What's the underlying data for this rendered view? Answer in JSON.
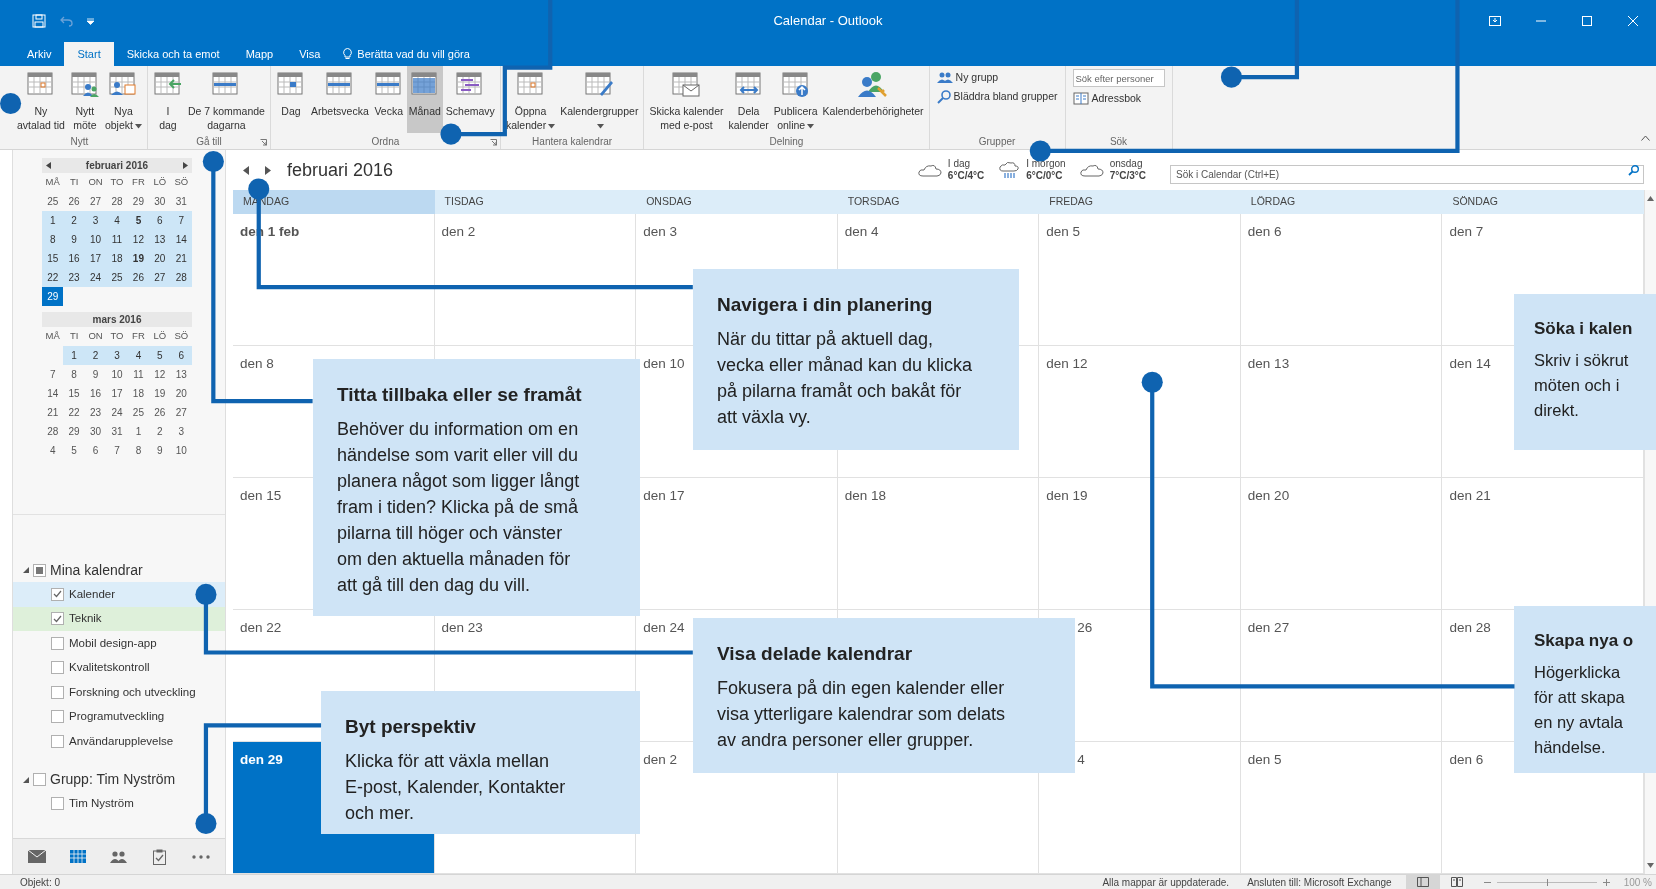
{
  "window": {
    "title": "Calendar - Outlook"
  },
  "ribbon_tabs": [
    {
      "label": "Arkiv",
      "selected": false
    },
    {
      "label": "Start",
      "selected": true
    },
    {
      "label": "Skicka och ta emot",
      "selected": false
    },
    {
      "label": "Mapp",
      "selected": false
    },
    {
      "label": "Visa",
      "selected": false
    }
  ],
  "tell_me": "Berätta vad du vill göra",
  "ribbon_groups": [
    {
      "name": "Nytt",
      "kind": "large",
      "launcher": false,
      "buttons": [
        {
          "label": "Ny\navtalad tid",
          "kind": "appointment",
          "menu": false,
          "selected": false
        },
        {
          "label": "Nytt\nmöte",
          "kind": "meeting",
          "menu": false,
          "selected": false
        },
        {
          "label": "Nya\nobjekt",
          "kind": "items",
          "menu": true,
          "selected": false
        }
      ]
    },
    {
      "name": "Gå till",
      "kind": "large",
      "launcher": true,
      "buttons": [
        {
          "label": "I\ndag",
          "kind": "today",
          "menu": false,
          "selected": false
        },
        {
          "label": "De 7 kommande\ndagarna",
          "kind": "week",
          "menu": false,
          "selected": false
        }
      ]
    },
    {
      "name": "Ordna",
      "kind": "large",
      "launcher": true,
      "buttons": [
        {
          "label": "Dag",
          "kind": "day",
          "menu": false,
          "selected": false
        },
        {
          "label": "Arbetsvecka",
          "kind": "week",
          "menu": false,
          "selected": false
        },
        {
          "label": "Vecka",
          "kind": "week",
          "menu": false,
          "selected": false
        },
        {
          "label": "Månad",
          "kind": "month",
          "menu": false,
          "selected": true
        },
        {
          "label": "Schemavy",
          "kind": "schedule",
          "menu": false,
          "selected": false
        }
      ]
    },
    {
      "name": "Hantera kalendrar",
      "kind": "large",
      "launcher": false,
      "buttons": [
        {
          "label": "Öppna\nkalender",
          "kind": "appointment",
          "menu": true,
          "selected": false
        },
        {
          "label": "Kalendergrupper\n",
          "kind": "groups",
          "menu": true,
          "selected": false
        }
      ]
    },
    {
      "name": "Delning",
      "kind": "large",
      "launcher": false,
      "buttons": [
        {
          "label": "Skicka kalender\nmed e-post",
          "kind": "email",
          "menu": false,
          "selected": false
        },
        {
          "label": "Dela\nkalender",
          "kind": "share",
          "menu": false,
          "selected": false
        },
        {
          "label": "Publicera\nonline",
          "kind": "publish",
          "menu": true,
          "selected": false
        },
        {
          "label": "Kalenderbehörigheter",
          "kind": "permissions",
          "menu": false,
          "selected": false
        }
      ]
    },
    {
      "name": "Grupper",
      "kind": "small",
      "launcher": false,
      "buttons": [
        {
          "label": "Ny grupp",
          "kind": "people",
          "menu": false,
          "selected": false
        },
        {
          "label": "Bläddra bland grupper",
          "kind": "browse",
          "menu": false,
          "selected": false
        }
      ]
    },
    {
      "name": "Sök",
      "kind": "search",
      "launcher": false,
      "placeholder": "Sök efter personer",
      "buttons": [
        {
          "label": "Adressbok",
          "kind": "book",
          "menu": false,
          "selected": false
        }
      ]
    }
  ],
  "mini_calendars": [
    {
      "title": "februari 2016",
      "arrows": true,
      "weekdays": [
        "MÅ",
        "TI",
        "ON",
        "TO",
        "FR",
        "LÖ",
        "SÖ"
      ],
      "rows": [
        {
          "kind": "full",
          "shaded": false,
          "days": [
            {
              "label": "25",
              "bold": false,
              "selected": false
            },
            {
              "label": "26",
              "bold": false,
              "selected": false
            },
            {
              "label": "27",
              "bold": false,
              "selected": false
            },
            {
              "label": "28",
              "bold": false,
              "selected": false
            },
            {
              "label": "29",
              "bold": false,
              "selected": false
            },
            {
              "label": "30",
              "bold": false,
              "selected": false
            },
            {
              "label": "31",
              "bold": false,
              "selected": false
            }
          ]
        },
        {
          "kind": "full",
          "shaded": true,
          "days": [
            {
              "label": "1",
              "bold": false,
              "selected": false
            },
            {
              "label": "2",
              "bold": false,
              "selected": false
            },
            {
              "label": "3",
              "bold": false,
              "selected": false
            },
            {
              "label": "4",
              "bold": false,
              "selected": false
            },
            {
              "label": "5",
              "bold": true,
              "selected": false
            },
            {
              "label": "6",
              "bold": false,
              "selected": false
            },
            {
              "label": "7",
              "bold": false,
              "selected": false
            }
          ]
        },
        {
          "kind": "full",
          "shaded": true,
          "days": [
            {
              "label": "8",
              "bold": false,
              "selected": false
            },
            {
              "label": "9",
              "bold": false,
              "selected": false
            },
            {
              "label": "10",
              "bold": false,
              "selected": false
            },
            {
              "label": "11",
              "bold": false,
              "selected": false
            },
            {
              "label": "12",
              "bold": false,
              "selected": false
            },
            {
              "label": "13",
              "bold": false,
              "selected": false
            },
            {
              "label": "14",
              "bold": false,
              "selected": false
            }
          ]
        },
        {
          "kind": "full",
          "shaded": true,
          "days": [
            {
              "label": "15",
              "bold": false,
              "selected": false
            },
            {
              "label": "16",
              "bold": false,
              "selected": false
            },
            {
              "label": "17",
              "bold": false,
              "selected": false
            },
            {
              "label": "18",
              "bold": false,
              "selected": false
            },
            {
              "label": "19",
              "bold": true,
              "selected": false
            },
            {
              "label": "20",
              "bold": false,
              "selected": false
            },
            {
              "label": "21",
              "bold": false,
              "selected": false
            }
          ]
        },
        {
          "kind": "full",
          "shaded": true,
          "days": [
            {
              "label": "22",
              "bold": false,
              "selected": false
            },
            {
              "label": "23",
              "bold": false,
              "selected": false
            },
            {
              "label": "24",
              "bold": false,
              "selected": false
            },
            {
              "label": "25",
              "bold": false,
              "selected": false
            },
            {
              "label": "26",
              "bold": false,
              "selected": false
            },
            {
              "label": "27",
              "bold": false,
              "selected": false
            },
            {
              "label": "28",
              "bold": false,
              "selected": false
            }
          ]
        },
        {
          "kind": "partial_end",
          "shaded": false,
          "days": [
            {
              "label": "29",
              "bold": false,
              "selected": true
            }
          ]
        }
      ]
    },
    {
      "title": "mars 2016",
      "arrows": false,
      "weekdays": [
        "MÅ",
        "TI",
        "ON",
        "TO",
        "FR",
        "LÖ",
        "SÖ"
      ],
      "rows": [
        {
          "kind": "partial_start",
          "shaded": true,
          "days": [
            {
              "label": "1",
              "bold": false,
              "selected": false
            },
            {
              "label": "2",
              "bold": false,
              "selected": false
            },
            {
              "label": "3",
              "bold": false,
              "selected": false
            },
            {
              "label": "4",
              "bold": false,
              "selected": false
            },
            {
              "label": "5",
              "bold": false,
              "selected": false
            },
            {
              "label": "6",
              "bold": false,
              "selected": false
            }
          ]
        },
        {
          "kind": "full",
          "shaded": false,
          "days": [
            {
              "label": "7",
              "bold": false,
              "selected": false
            },
            {
              "label": "8",
              "bold": false,
              "selected": false
            },
            {
              "label": "9",
              "bold": false,
              "selected": false
            },
            {
              "label": "10",
              "bold": false,
              "selected": false
            },
            {
              "label": "11",
              "bold": false,
              "selected": false
            },
            {
              "label": "12",
              "bold": false,
              "selected": false
            },
            {
              "label": "13",
              "bold": false,
              "selected": false
            }
          ]
        },
        {
          "kind": "full",
          "shaded": false,
          "days": [
            {
              "label": "14",
              "bold": false,
              "selected": false
            },
            {
              "label": "15",
              "bold": false,
              "selected": false
            },
            {
              "label": "16",
              "bold": false,
              "selected": false
            },
            {
              "label": "17",
              "bold": false,
              "selected": false
            },
            {
              "label": "18",
              "bold": false,
              "selected": false
            },
            {
              "label": "19",
              "bold": false,
              "selected": false
            },
            {
              "label": "20",
              "bold": false,
              "selected": false
            }
          ]
        },
        {
          "kind": "full",
          "shaded": false,
          "days": [
            {
              "label": "21",
              "bold": false,
              "selected": false
            },
            {
              "label": "22",
              "bold": false,
              "selected": false
            },
            {
              "label": "23",
              "bold": false,
              "selected": false
            },
            {
              "label": "24",
              "bold": false,
              "selected": false
            },
            {
              "label": "25",
              "bold": false,
              "selected": false
            },
            {
              "label": "26",
              "bold": false,
              "selected": false
            },
            {
              "label": "27",
              "bold": false,
              "selected": false
            }
          ]
        },
        {
          "kind": "full",
          "shaded": false,
          "days": [
            {
              "label": "28",
              "bold": false,
              "selected": false
            },
            {
              "label": "29",
              "bold": false,
              "selected": false
            },
            {
              "label": "30",
              "bold": false,
              "selected": false
            },
            {
              "label": "31",
              "bold": false,
              "selected": false
            },
            {
              "label": "1",
              "bold": false,
              "selected": false
            },
            {
              "label": "2",
              "bold": false,
              "selected": false
            },
            {
              "label": "3",
              "bold": false,
              "selected": false
            }
          ]
        },
        {
          "kind": "full",
          "shaded": false,
          "days": [
            {
              "label": "4",
              "bold": false,
              "selected": false
            },
            {
              "label": "5",
              "bold": false,
              "selected": false
            },
            {
              "label": "6",
              "bold": false,
              "selected": false
            },
            {
              "label": "7",
              "bold": false,
              "selected": false
            },
            {
              "label": "8",
              "bold": false,
              "selected": false
            },
            {
              "label": "9",
              "bold": false,
              "selected": false
            },
            {
              "label": "10",
              "bold": false,
              "selected": false
            }
          ]
        }
      ]
    }
  ],
  "calendar_groups": [
    {
      "label": "Mina kalendrar",
      "expanded": true,
      "checked": false,
      "partial": true,
      "items": [
        {
          "label": "Kalender",
          "checked": true,
          "color": "#dcedf9"
        },
        {
          "label": "Teknik",
          "checked": true,
          "color": "#def0da"
        },
        {
          "label": "Mobil design-app",
          "checked": false
        },
        {
          "label": "Kvalitetskontroll",
          "checked": false
        },
        {
          "label": "Forskning och utveckling",
          "checked": false
        },
        {
          "label": "Programutveckling",
          "checked": false
        },
        {
          "label": "Användarupplevelse",
          "checked": false
        }
      ]
    },
    {
      "label": "Grupp: Tim Nyström",
      "expanded": true,
      "checked": false,
      "partial": false,
      "items": [
        {
          "label": "Tim Nyström",
          "checked": false
        }
      ]
    }
  ],
  "nav": [
    {
      "kind": "mail",
      "selected": false
    },
    {
      "kind": "calendar",
      "selected": true
    },
    {
      "kind": "people",
      "selected": false
    },
    {
      "kind": "tasks",
      "selected": false
    },
    {
      "kind": "more",
      "selected": false
    }
  ],
  "calendar_header": {
    "title": "februari 2016",
    "weather": [
      {
        "day": "I dag",
        "temp": "6°C/4°C",
        "kind": "cloud"
      },
      {
        "day": "I morgon",
        "temp": "6°C/0°C",
        "kind": "rain"
      },
      {
        "day": "onsdag",
        "temp": "7°C/3°C",
        "kind": "cloud"
      }
    ],
    "search_placeholder": "Sök i Calendar (Ctrl+E)"
  },
  "weekdays": [
    {
      "label": "MÅNDAG",
      "selected": true
    },
    {
      "label": "TISDAG",
      "selected": false
    },
    {
      "label": "ONSDAG",
      "selected": false
    },
    {
      "label": "TORSDAG",
      "selected": false
    },
    {
      "label": "FREDAG",
      "selected": false
    },
    {
      "label": "LÖRDAG",
      "selected": false
    },
    {
      "label": "SÖNDAG",
      "selected": false
    }
  ],
  "weeks": [
    [
      {
        "label": "den 1 feb",
        "kind": "month_start",
        "selected": false
      },
      {
        "label": "den 2",
        "kind": "day",
        "selected": false
      },
      {
        "label": "den 3",
        "kind": "day",
        "selected": false
      },
      {
        "label": "den 4",
        "kind": "day",
        "selected": false
      },
      {
        "label": "den 5",
        "kind": "day",
        "selected": false
      },
      {
        "label": "den 6",
        "kind": "day",
        "selected": false
      },
      {
        "label": "den 7",
        "kind": "day",
        "selected": false
      }
    ],
    [
      {
        "label": "den 8",
        "kind": "day",
        "selected": false
      },
      {
        "kind": "empty"
      },
      {
        "label": "den 10",
        "kind": "day",
        "selected": false
      },
      {
        "kind": "empty"
      },
      {
        "label": "den 12",
        "kind": "day",
        "selected": false
      },
      {
        "label": "den 13",
        "kind": "day",
        "selected": false
      },
      {
        "label": "den 14",
        "kind": "day",
        "selected": false
      }
    ],
    [
      {
        "label": "den 15",
        "kind": "day",
        "selected": false
      },
      {
        "kind": "empty"
      },
      {
        "label": "den 17",
        "kind": "day",
        "selected": false
      },
      {
        "label": "den 18",
        "kind": "day",
        "selected": false
      },
      {
        "label": "den 19",
        "kind": "day",
        "selected": false
      },
      {
        "label": "den 20",
        "kind": "day",
        "selected": false
      },
      {
        "label": "den 21",
        "kind": "day",
        "selected": false
      }
    ],
    [
      {
        "label": "den 22",
        "kind": "day",
        "selected": false
      },
      {
        "label": "den 23",
        "kind": "day",
        "selected": false
      },
      {
        "label": "den 24",
        "kind": "day",
        "selected": false
      },
      {
        "kind": "empty"
      },
      {
        "label": "26",
        "kind": "cut",
        "selected": false
      },
      {
        "label": "den 27",
        "kind": "day",
        "selected": false
      },
      {
        "label": "den 28",
        "kind": "day",
        "selected": false
      }
    ],
    [
      {
        "label": "den 29",
        "kind": "day",
        "selected": true
      },
      {
        "kind": "empty"
      },
      {
        "label": "den 2",
        "kind": "day",
        "selected": false
      },
      {
        "kind": "empty"
      },
      {
        "label": "4",
        "kind": "cut",
        "selected": false
      },
      {
        "label": "den 5",
        "kind": "day",
        "selected": false
      },
      {
        "label": "den 6",
        "kind": "day",
        "selected": false
      }
    ]
  ],
  "callouts": [
    {
      "title": "Navigera i din planering",
      "body": "När du tittar på aktuell dag,\nvecka eller månad kan du klicka\npå pilarna framåt och bakåt för\natt växla vy.",
      "kind": "full"
    },
    {
      "title": "Söka i kalen",
      "body": "Skriv i sökrut\nmöten och i\ndirekt.",
      "kind": "cut"
    },
    {
      "title": "Titta tillbaka eller se framåt",
      "body": "Behöver du information om en\nhändelse som varit eller vill du\nplanera något som ligger långt\nfram i tiden? Klicka på de små\npilarna till höger och vänster\nom den aktuella månaden för\natt gå till den dag du vill.",
      "kind": "full"
    },
    {
      "title": "Visa delade kalendrar",
      "body": "Fokusera på din egen kalender eller\nvisa ytterligare kalendrar som delats\nav andra personer eller grupper.",
      "kind": "full"
    },
    {
      "title": "Skapa nya o",
      "body": "Högerklicka\nför att skapa\nen ny avtala\nhändelse.",
      "kind": "cut"
    },
    {
      "title": "Byt perspektiv",
      "body": "Klicka för att växla mellan\nE-post, Kalender, Kontakter\noch mer.",
      "kind": "full"
    }
  ],
  "status_bar": {
    "count": "Objekt: 0",
    "sync": "Alla mappar är uppdaterade.",
    "connection": "Ansluten till: Microsoft Exchange",
    "views": [
      {
        "kind": "normal",
        "selected": true
      },
      {
        "kind": "reading",
        "selected": false
      }
    ],
    "zoom": {
      "level": 0.5,
      "reading": "100 %"
    }
  }
}
